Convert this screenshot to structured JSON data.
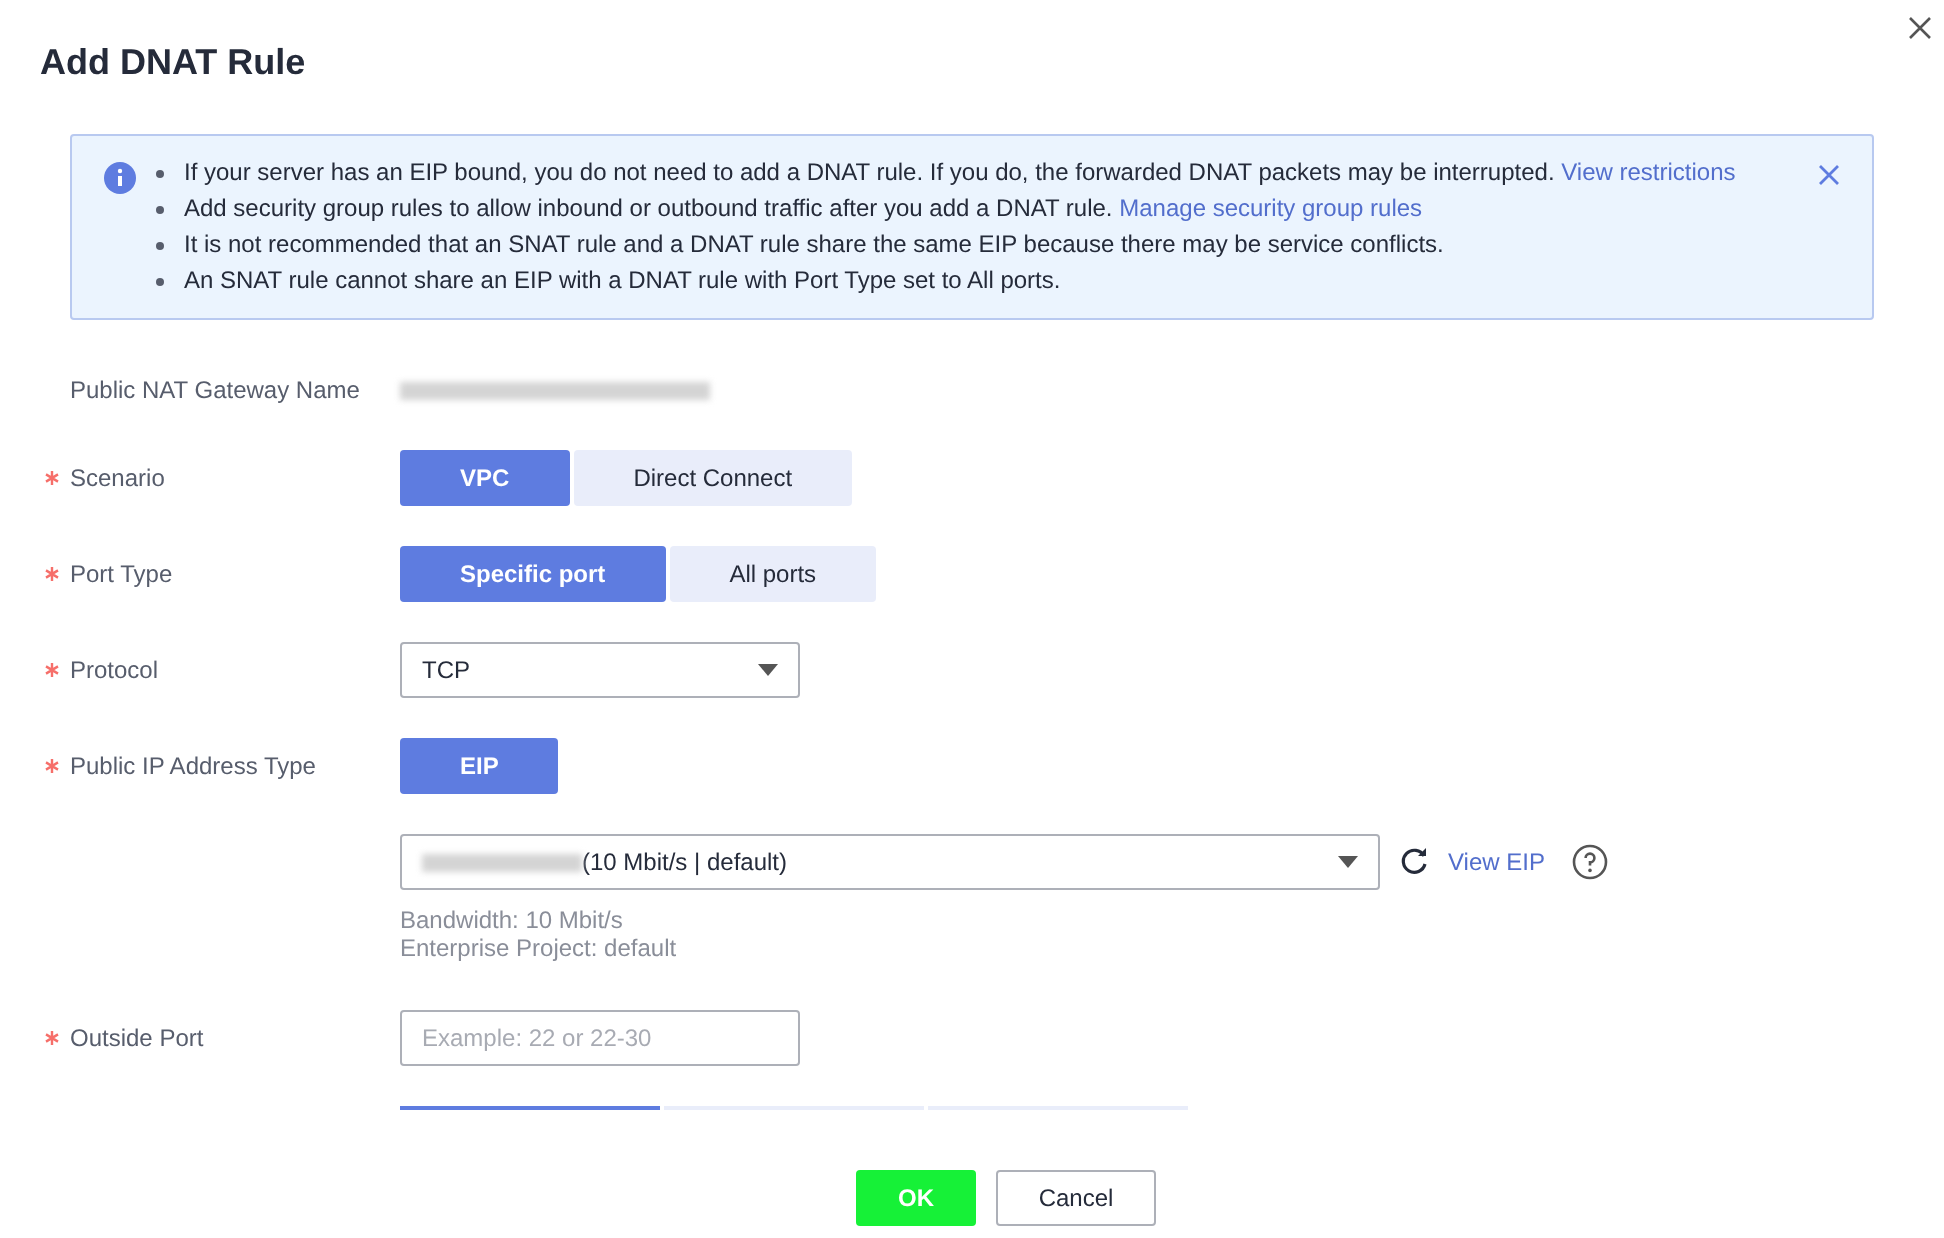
{
  "dialog": {
    "title": "Add DNAT Rule"
  },
  "notice": {
    "items": [
      {
        "text": "If your server has an EIP bound, you do not need to add a DNAT rule. If you do, the forwarded DNAT packets may be interrupted.",
        "link": "View restrictions"
      },
      {
        "text": "Add security group rules to allow inbound or outbound traffic after you add a DNAT rule.",
        "link": "Manage security group rules"
      },
      {
        "text": "It is not recommended that an SNAT rule and a DNAT rule share the same EIP because there may be service conflicts."
      },
      {
        "text": "An SNAT rule cannot share an EIP with a DNAT rule with Port Type set to All ports."
      }
    ]
  },
  "fields": [
    {
      "kind": "redacted",
      "label": "Public NAT Gateway Name",
      "required": false
    },
    {
      "kind": "segmented",
      "label": "Scenario",
      "required": true,
      "options": [
        {
          "label": "VPC",
          "selected": true
        },
        {
          "label": "Direct Connect",
          "selected": false
        }
      ]
    },
    {
      "kind": "segmented",
      "label": "Port Type",
      "required": true,
      "options": [
        {
          "label": "Specific port",
          "selected": true
        },
        {
          "label": "All ports",
          "selected": false
        }
      ]
    },
    {
      "kind": "select",
      "label": "Protocol",
      "required": true,
      "value": "TCP"
    },
    {
      "kind": "segmented",
      "label": "Public IP Address Type",
      "required": true,
      "options": [
        {
          "label": "EIP",
          "selected": true
        }
      ]
    },
    {
      "kind": "eip",
      "value": "(10 Mbit/s | default)",
      "link": "View EIP",
      "notes": [
        "Bandwidth: 10 Mbit/s",
        "Enterprise Project: default"
      ]
    },
    {
      "kind": "input",
      "label": "Outside Port",
      "required": true,
      "placeholder": "Example: 22 or 22-30"
    },
    {
      "kind": "tabs",
      "tabs": [
        {
          "selected": true
        },
        {
          "selected": false
        },
        {
          "selected": false
        }
      ]
    }
  ],
  "buttons": [
    {
      "label": "OK",
      "kind": "primary"
    },
    {
      "label": "Cancel",
      "kind": "secondary"
    }
  ]
}
